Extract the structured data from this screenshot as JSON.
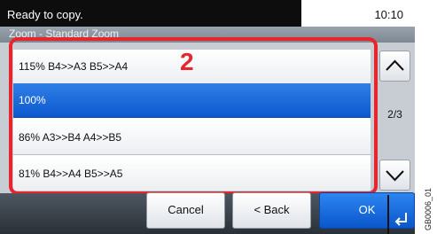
{
  "status": {
    "message": "Ready to copy.",
    "time": "10:10"
  },
  "title": "Zoom - Standard Zoom",
  "callout_number": "2",
  "zoom_options": [
    {
      "label": "115% B4>>A3 B5>>A4",
      "selected": false
    },
    {
      "label": "100%",
      "selected": true
    },
    {
      "label": "86% A3>>B4 A4>>B5",
      "selected": false
    },
    {
      "label": "81% B4>>A4 B5>>A5",
      "selected": false
    }
  ],
  "pagination": "2/3",
  "buttons": {
    "cancel": "Cancel",
    "back": "< Back",
    "ok": "OK"
  },
  "figure_code": "GB0006_01",
  "icons": {
    "scroll_up": "chevron-up-icon",
    "scroll_down": "chevron-down-icon",
    "ok_enter": "enter-arrow-icon"
  },
  "colors": {
    "selected_row": "#1565d8",
    "callout": "#e8242c",
    "ok_button": "#1a6fe0"
  }
}
